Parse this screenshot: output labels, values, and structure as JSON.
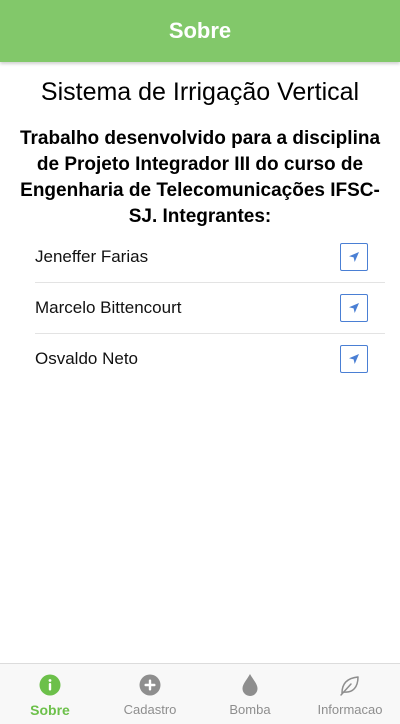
{
  "header": {
    "title": "Sobre",
    "color": "#82c86a"
  },
  "main": {
    "title": "Sistema de Irrigação Vertical",
    "subtitle": "Trabalho desenvolvido para a disciplina de Projeto Integrador III do curso de Engenharia de Telecomunicações IFSC-SJ. Integrantes:",
    "members": [
      {
        "name": "Jeneffer Farias",
        "icon": "navigate-icon"
      },
      {
        "name": "Marcelo Bittencourt",
        "icon": "navigate-icon"
      },
      {
        "name": "Osvaldo Neto",
        "icon": "navigate-icon"
      }
    ]
  },
  "tabs": [
    {
      "label": "Sobre",
      "icon": "info-icon",
      "active": true
    },
    {
      "label": "Cadastro",
      "icon": "add-circle-icon",
      "active": false
    },
    {
      "label": "Bomba",
      "icon": "water-drop-icon",
      "active": false
    },
    {
      "label": "Informacao",
      "icon": "leaf-icon",
      "active": false
    }
  ],
  "colors": {
    "accent": "#6cc04a",
    "link": "#4a7fd4",
    "inactive": "#8e8e8e"
  }
}
